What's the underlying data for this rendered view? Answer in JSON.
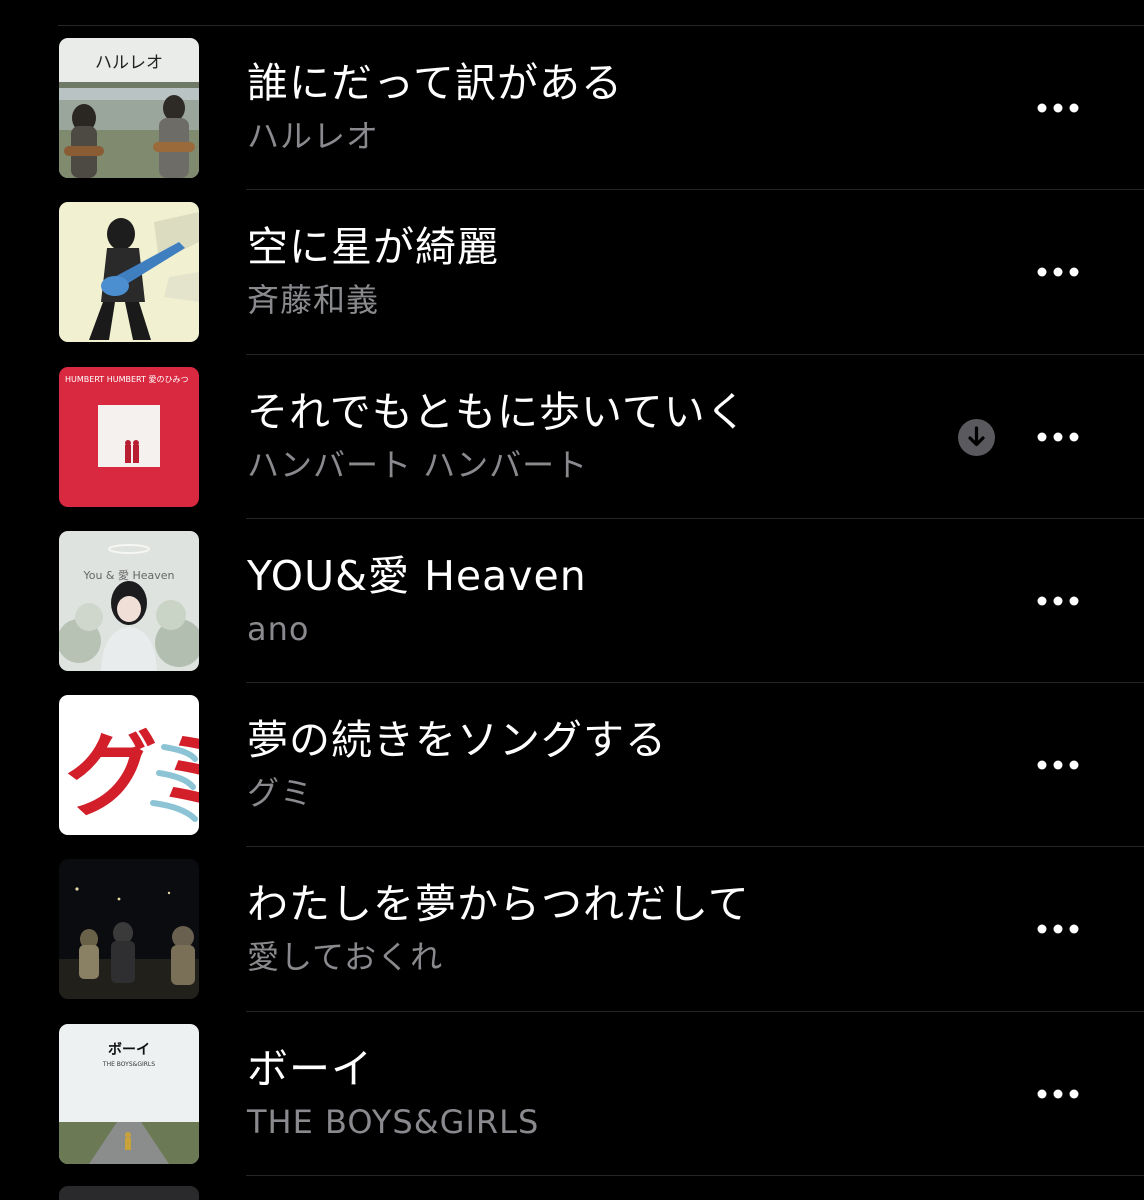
{
  "songs": [
    {
      "title": "誰にだって訳がある",
      "artist": "ハルレオ",
      "art_label": "ハルレオ",
      "downloaded": false
    },
    {
      "title": "空に星が綺麗",
      "artist": "斉藤和義",
      "art_label": "",
      "downloaded": false
    },
    {
      "title": "それでもともに歩いていく",
      "artist": "ハンバート ハンバート",
      "art_label": "HUMBERT HUMBERT 愛のひみつ",
      "downloaded": true
    },
    {
      "title": "YOU&愛 Heaven",
      "artist": "ano",
      "art_label": "You & 愛 Heaven",
      "downloaded": false
    },
    {
      "title": "夢の続きをソングする",
      "artist": "グミ",
      "art_label": "グミ",
      "downloaded": false
    },
    {
      "title": "わたしを夢からつれだして",
      "artist": "愛しておくれ",
      "art_label": "",
      "downloaded": false
    },
    {
      "title": "ボーイ",
      "artist": "THE BOYS&GIRLS",
      "art_label": "ボーイ",
      "art_sublabel": "THE BOYS&GIRLS",
      "downloaded": false
    }
  ],
  "icons": {
    "more": "ellipsis-icon",
    "download": "download-arrow-icon"
  },
  "colors": {
    "background": "#000000",
    "title": "#ffffff",
    "subtitle": "#8a8a8e",
    "separator": "#262626",
    "download_badge": "#5a5a5e"
  }
}
